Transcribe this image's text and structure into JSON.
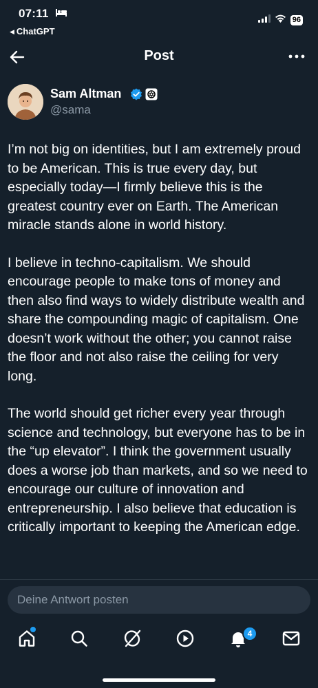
{
  "status_bar": {
    "time": "07:11",
    "back_app": "ChatGPT",
    "battery": "96"
  },
  "header": {
    "title": "Post"
  },
  "author": {
    "name": "Sam Altman",
    "handle": "@sama",
    "verified": true
  },
  "tweet": {
    "paragraphs": [
      "I’m not big on identities, but I am extremely proud to be American. This is true every day, but especially today—I firmly believe this is the greatest country ever on Earth. The American miracle stands alone in world history.",
      "I believe in techno-capitalism. We should encourage people to make tons of money and then also find ways to widely distribute wealth and share the compounding magic of capitalism. One doesn’t work without the other; you cannot raise the floor and not also raise the ceiling for very long.",
      "The world should get richer every year through science and technology, but everyone has to be in the “up elevator”. I think the government usually does a worse job than markets, and so we need to encourage our culture of innovation and entrepreneurship. I also believe that education is critically important to keeping the American edge."
    ]
  },
  "reply": {
    "placeholder": "Deine Antwort posten"
  },
  "tabbar": {
    "items": [
      "home-icon",
      "search-icon",
      "grok-icon",
      "play-icon",
      "bell-icon",
      "mail-icon"
    ],
    "notification_count": "4"
  },
  "colors": {
    "background": "#15202b",
    "accent": "#1d9bf0",
    "secondary_text": "#8b98a5"
  }
}
